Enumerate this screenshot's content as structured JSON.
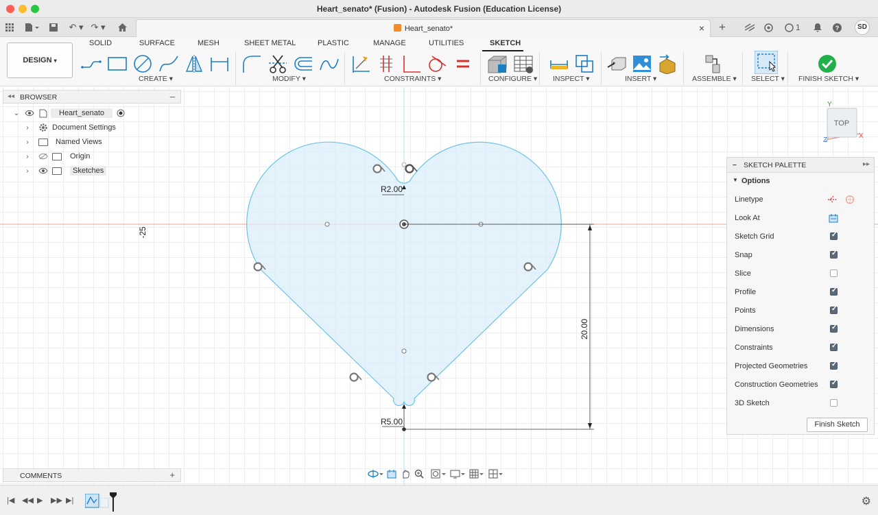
{
  "window": {
    "title": "Heart_senato* (Fusion) - Autodesk Fusion (Education License)"
  },
  "tabbar": {
    "doc_tab": "Heart_senato*",
    "jobs_count": "1",
    "user_initials": "SD"
  },
  "toolbar": {
    "workspace": "DESIGN",
    "workspace_tabs": [
      "SOLID",
      "SURFACE",
      "MESH",
      "SHEET METAL",
      "PLASTIC",
      "MANAGE",
      "UTILITIES",
      "SKETCH"
    ],
    "active_tab": "SKETCH",
    "groups": {
      "create": "CREATE",
      "modify": "MODIFY",
      "constraints": "CONSTRAINTS",
      "configure": "CONFIGURE",
      "inspect": "INSPECT",
      "insert": "INSERT",
      "assemble": "ASSEMBLE",
      "select": "SELECT",
      "finish_sketch": "FINISH SKETCH"
    }
  },
  "browser": {
    "title": "BROWSER",
    "items": [
      {
        "label": "Heart_senato"
      },
      {
        "label": "Document Settings"
      },
      {
        "label": "Named Views"
      },
      {
        "label": "Origin"
      },
      {
        "label": "Sketches"
      }
    ]
  },
  "comments": {
    "title": "COMMENTS"
  },
  "viewcube": {
    "face": "TOP",
    "axis_x": "X",
    "axis_y": "Y",
    "axis_z": "Z"
  },
  "sketch": {
    "ruler_label": "-25",
    "dim_top_radius": "R2.00",
    "dim_bottom_radius": "R5.00",
    "dim_height": "20.00"
  },
  "palette": {
    "title": "SKETCH PALETTE",
    "section": "Options",
    "options": [
      {
        "label": "Linetype",
        "kind": "icons"
      },
      {
        "label": "Look At",
        "kind": "icon"
      },
      {
        "label": "Sketch Grid",
        "checked": true
      },
      {
        "label": "Snap",
        "checked": true
      },
      {
        "label": "Slice",
        "checked": false
      },
      {
        "label": "Profile",
        "checked": true
      },
      {
        "label": "Points",
        "checked": true
      },
      {
        "label": "Dimensions",
        "checked": true
      },
      {
        "label": "Constraints",
        "checked": true
      },
      {
        "label": "Projected Geometries",
        "checked": true
      },
      {
        "label": "Construction Geometries",
        "checked": true
      },
      {
        "label": "3D Sketch",
        "checked": false
      }
    ],
    "finish_button": "Finish Sketch"
  }
}
